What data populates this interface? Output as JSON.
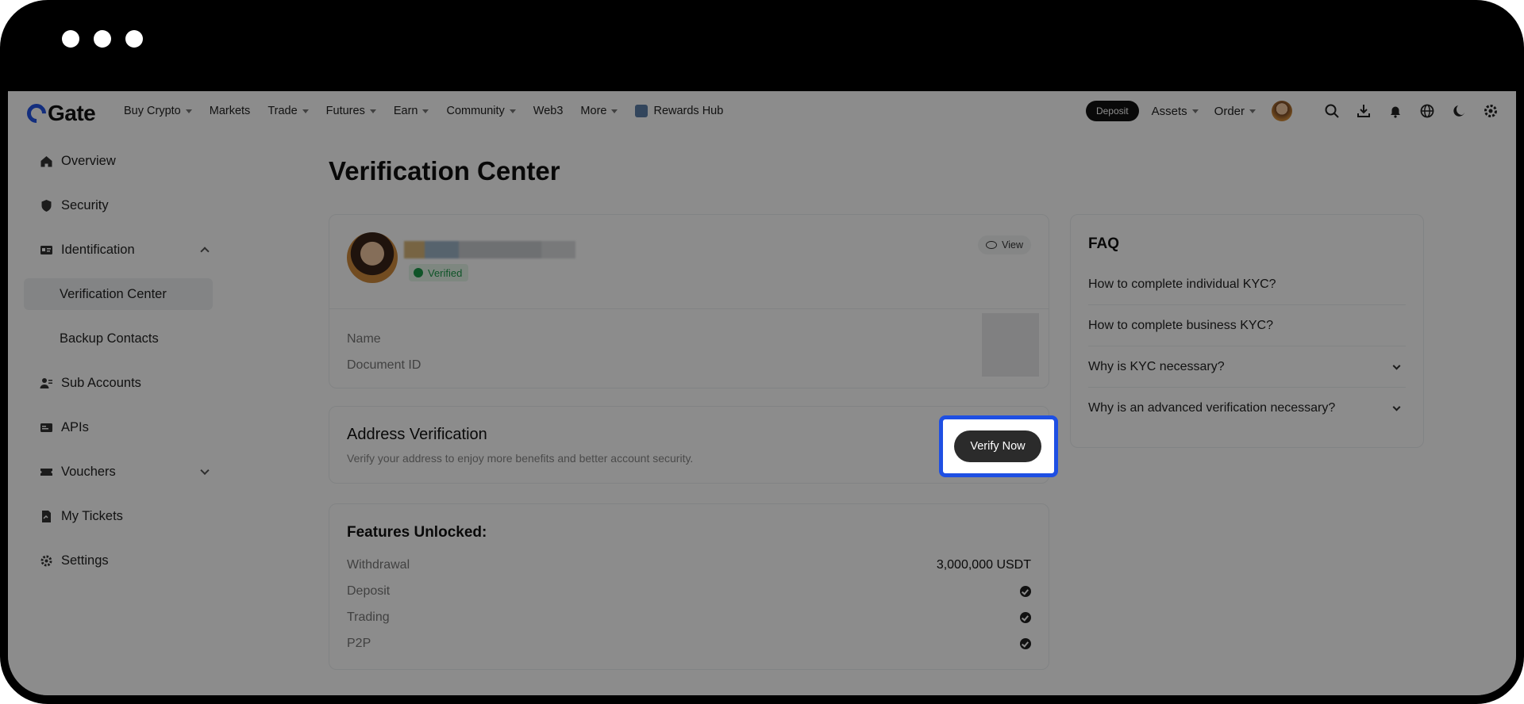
{
  "nav": {
    "logo": "Gate",
    "items": [
      {
        "label": "Buy Crypto",
        "caret": true
      },
      {
        "label": "Markets",
        "caret": false
      },
      {
        "label": "Trade",
        "caret": true
      },
      {
        "label": "Futures",
        "caret": true
      },
      {
        "label": "Earn",
        "caret": true
      },
      {
        "label": "Community",
        "caret": true
      },
      {
        "label": "Web3",
        "caret": false
      },
      {
        "label": "More",
        "caret": true
      }
    ],
    "rewards": "Rewards Hub",
    "deposit": "Deposit",
    "assets": "Assets",
    "order": "Order"
  },
  "sidebar": {
    "items": [
      {
        "label": "Overview",
        "icon": "home-icon"
      },
      {
        "label": "Security",
        "icon": "shield-icon"
      },
      {
        "label": "Identification",
        "icon": "id-card-icon"
      },
      {
        "label": "Verification Center"
      },
      {
        "label": "Backup Contacts"
      },
      {
        "label": "Sub Accounts",
        "icon": "users-icon"
      },
      {
        "label": "APIs",
        "icon": "api-icon"
      },
      {
        "label": "Vouchers",
        "icon": "ticket-icon"
      },
      {
        "label": "My Tickets",
        "icon": "document-icon"
      },
      {
        "label": "Settings",
        "icon": "gear-icon"
      }
    ]
  },
  "main": {
    "title": "Verification Center",
    "profile": {
      "status": "Verified",
      "view": "View",
      "name_label": "Name",
      "doc_label": "Document ID"
    },
    "address": {
      "title": "Address Verification",
      "desc": "Verify your address to enjoy more benefits and better account security.",
      "button": "Verify Now"
    },
    "features": {
      "title": "Features Unlocked:",
      "rows": [
        {
          "label": "Withdrawal",
          "value": "3,000,000 USDT"
        },
        {
          "label": "Deposit",
          "value": ""
        },
        {
          "label": "Trading",
          "value": ""
        },
        {
          "label": "P2P",
          "value": ""
        }
      ]
    }
  },
  "faq": {
    "title": "FAQ",
    "items": [
      "How to complete individual KYC?",
      "How to complete business KYC?",
      "Why is KYC necessary?",
      "Why is an advanced verification necessary?"
    ]
  },
  "colors": {
    "highlight": "#1e4fe3",
    "verified": "#1d9a4a",
    "dark_button": "#2b2b2b"
  }
}
